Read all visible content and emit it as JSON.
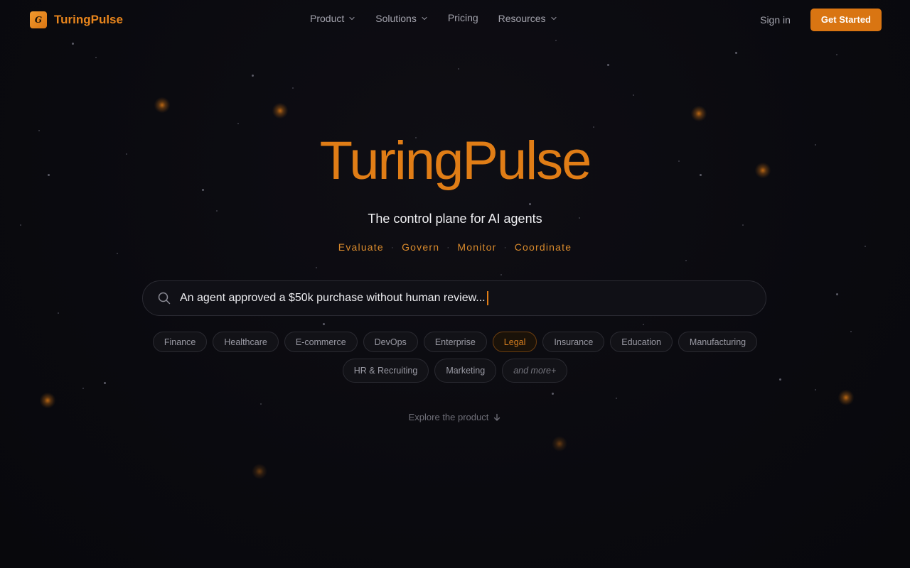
{
  "brand": {
    "name": "TuringPulse",
    "mark_letter": "G",
    "accent": "#d97512"
  },
  "nav": {
    "links": [
      {
        "label": "Product",
        "has_dropdown": true
      },
      {
        "label": "Solutions",
        "has_dropdown": true
      },
      {
        "label": "Pricing",
        "has_dropdown": false
      },
      {
        "label": "Resources",
        "has_dropdown": true
      }
    ],
    "sign_in": "Sign in",
    "cta": "Get Started"
  },
  "hero": {
    "title": "TuringPulse",
    "subtitle": "The control plane for AI agents",
    "pillars": [
      "Evaluate",
      "Govern",
      "Monitor",
      "Coordinate"
    ]
  },
  "search": {
    "value": "An agent approved a $50k purchase without human review..."
  },
  "industries": {
    "row1": [
      "Finance",
      "Healthcare",
      "E-commerce",
      "DevOps",
      "Enterprise",
      "Legal",
      "Insurance",
      "Education",
      "Manufacturing"
    ],
    "row2": [
      "HR & Recruiting",
      "Marketing"
    ],
    "more": "and more+",
    "selected": "Legal"
  },
  "explore": {
    "label": "Explore the product"
  }
}
